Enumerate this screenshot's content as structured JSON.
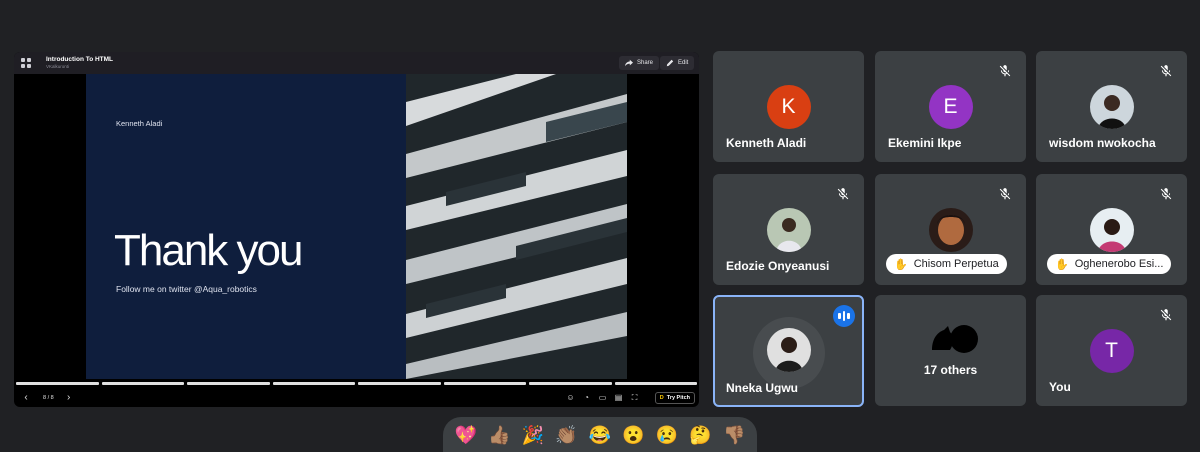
{
  "presentation": {
    "title": "Introduction To HTML",
    "subtitle": "VKalkuronti",
    "share_label": "Share",
    "edit_label": "Edit",
    "slide": {
      "author": "Kenneth Aladi",
      "heading": "Thank you",
      "follow": "Follow me on twitter @Aqua_robotics"
    },
    "page_indicator": "8 / 8",
    "progress_segments": 8,
    "try_pitch_label": "Try Pitch"
  },
  "participants": [
    {
      "name": "Kenneth Aladi",
      "initial": "K",
      "avatar_color": "#d93f12",
      "muted": false
    },
    {
      "name": "Ekemini Ikpe",
      "initial": "E",
      "avatar_color": "#9334c4",
      "muted": true
    },
    {
      "name": "wisdom nwokocha",
      "initial": "",
      "avatar_color": "",
      "muted": true
    },
    {
      "name": "Edozie Onyeanusi",
      "initial": "",
      "avatar_color": "",
      "muted": true
    },
    {
      "name": "Chisom Perpetua",
      "initial": "",
      "avatar_color": "",
      "muted": true,
      "hand_raised": true
    },
    {
      "name": "Oghenerobo Esi...",
      "initial": "",
      "avatar_color": "",
      "muted": true,
      "hand_raised": true
    },
    {
      "name": "Nneka Ugwu",
      "initial": "",
      "avatar_color": "",
      "muted": false,
      "speaking": true
    },
    {
      "name": "17 others",
      "initial": "",
      "avatar_color": "",
      "muted": false
    },
    {
      "name": "You",
      "initial": "T",
      "avatar_color": "#7727a7",
      "muted": true
    }
  ],
  "reactions": [
    "💖",
    "👍🏽",
    "🎉",
    "👏🏽",
    "😂",
    "😮",
    "😢",
    "🤔",
    "👎🏽"
  ],
  "colors": {
    "background": "#202124",
    "tile": "#3c4043",
    "active_border": "#8ab4f8",
    "slide_navy": "#0f1e3d"
  }
}
